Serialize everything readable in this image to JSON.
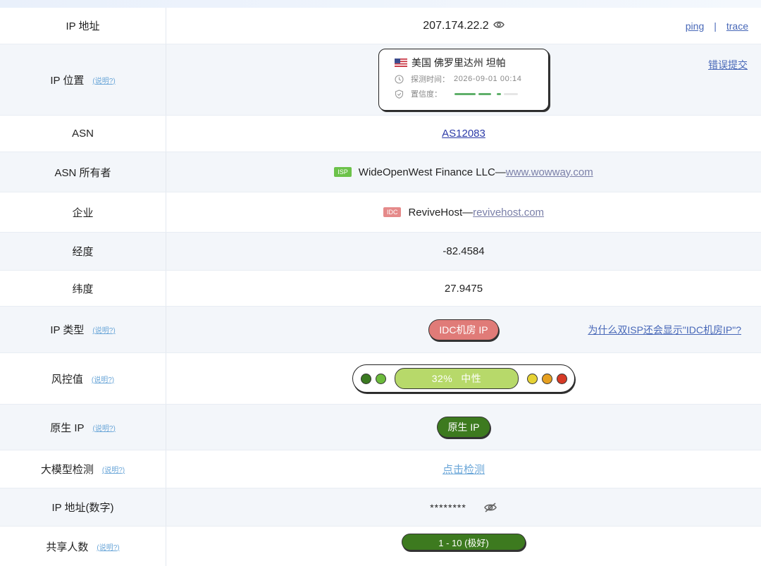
{
  "rows": {
    "ip": {
      "label": "IP 地址",
      "value": "207.174.22.2",
      "ping": "ping",
      "sep": "|",
      "trace": "trace"
    },
    "location": {
      "label": "IP 位置",
      "help": "(说明?)",
      "country_line": "美国 佛罗里达州 坦帕",
      "detect_label": "探测时间：",
      "detect_time": "2026-09-01 00:14",
      "confidence_label": "置信度：",
      "report": "错误提交"
    },
    "asn": {
      "label": "ASN",
      "value": "AS12083"
    },
    "asn_owner": {
      "label": "ASN 所有者",
      "badge": "ISP",
      "name": "WideOpenWest Finance LLC",
      "dash": "—",
      "site": "www.wowway.com"
    },
    "company": {
      "label": "企业",
      "badge": "IDC",
      "name": "ReviveHost",
      "dash": "—",
      "site": "revivehost.com"
    },
    "longitude": {
      "label": "经度",
      "value": "-82.4584"
    },
    "latitude": {
      "label": "纬度",
      "value": "27.9475"
    },
    "ip_type": {
      "label": "IP 类型",
      "help": "(说明?)",
      "value": "IDC机房 IP",
      "why": "为什么双ISP还会显示\"IDC机房IP\"?"
    },
    "risk": {
      "label": "风控值",
      "help": "(说明?)",
      "value": "32%",
      "level": "中性"
    },
    "native": {
      "label": "原生 IP",
      "help": "(说明?)",
      "value": "原生 IP"
    },
    "llm": {
      "label": "大模型检测",
      "help": "(说明?)",
      "value": "点击检测"
    },
    "ip_numeric": {
      "label": "IP 地址(数字)",
      "value": "********"
    },
    "shared": {
      "label": "共享人数",
      "help": "(说明?)",
      "value": "1 - 10 (极好)"
    }
  },
  "colors": {
    "link": "#2b3aa8",
    "help": "#6aa6d8",
    "isp_badge": "#6cc24a",
    "idc_badge": "#e58a8a",
    "idc_pill": "#e07b78",
    "native_pill": "#3d7a1f",
    "risk_bar": "#b7d96a",
    "risk_dots": [
      "#3b7a21",
      "#6cbb3c",
      "#e6d234",
      "#e6a020",
      "#d63a26"
    ]
  },
  "confidence_fraction": 0.72,
  "icons": [
    "eye-icon",
    "us-flag-icon",
    "clock-icon",
    "shield-icon",
    "eye-off-icon"
  ]
}
